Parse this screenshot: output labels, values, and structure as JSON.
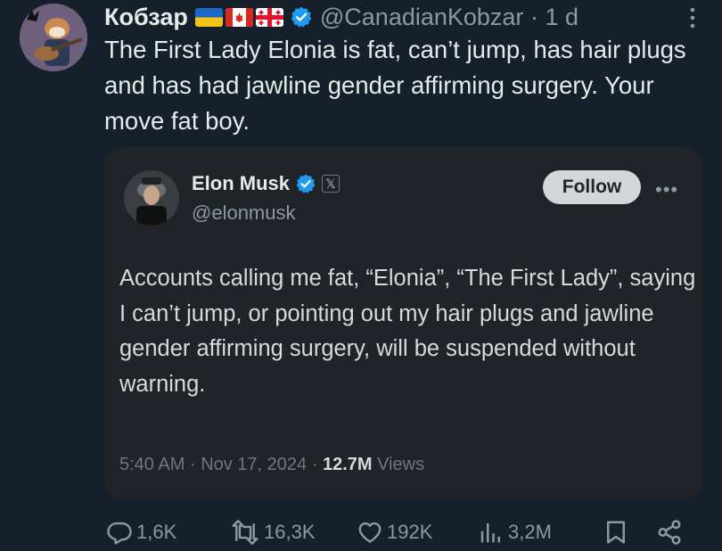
{
  "colors": {
    "background": "#15202b",
    "card_background": "#202327",
    "verified_blue": "#1d9bf0",
    "secondary_text": "#8b98a5",
    "follow_button": "#d3d5d7"
  },
  "tweet": {
    "display_name": "Кобзар",
    "flag_icons": [
      "ukraine-flag-icon",
      "canada-flag-icon",
      "georgia-flag-icon"
    ],
    "verified_icon": "verified-badge-icon",
    "handle": "@CanadianKobzar",
    "separator": "·",
    "time": "1 d",
    "text": "The First Lady Elonia is fat, can’t jump, has hair plugs and has had jawline gender affirming surgery. Your move fat boy."
  },
  "quote": {
    "display_name": "Elon Musk",
    "handle": "@elonmusk",
    "follow_label": "Follow",
    "more_label": "•••",
    "text": "Accounts calling me fat, “Elonia”, “The First Lady”, saying I can’t jump, or pointing out my hair plugs and jawline gender affirming surgery, will be suspended without warning.",
    "time": "5:40 AM",
    "sep1": "·",
    "date": "Nov 17, 2024",
    "sep2": "·",
    "views_count": "12.7M",
    "views_label": "Views"
  },
  "actions": {
    "replies": "1,6K",
    "reposts": "16,3K",
    "likes": "192K",
    "views": "3,2M"
  }
}
